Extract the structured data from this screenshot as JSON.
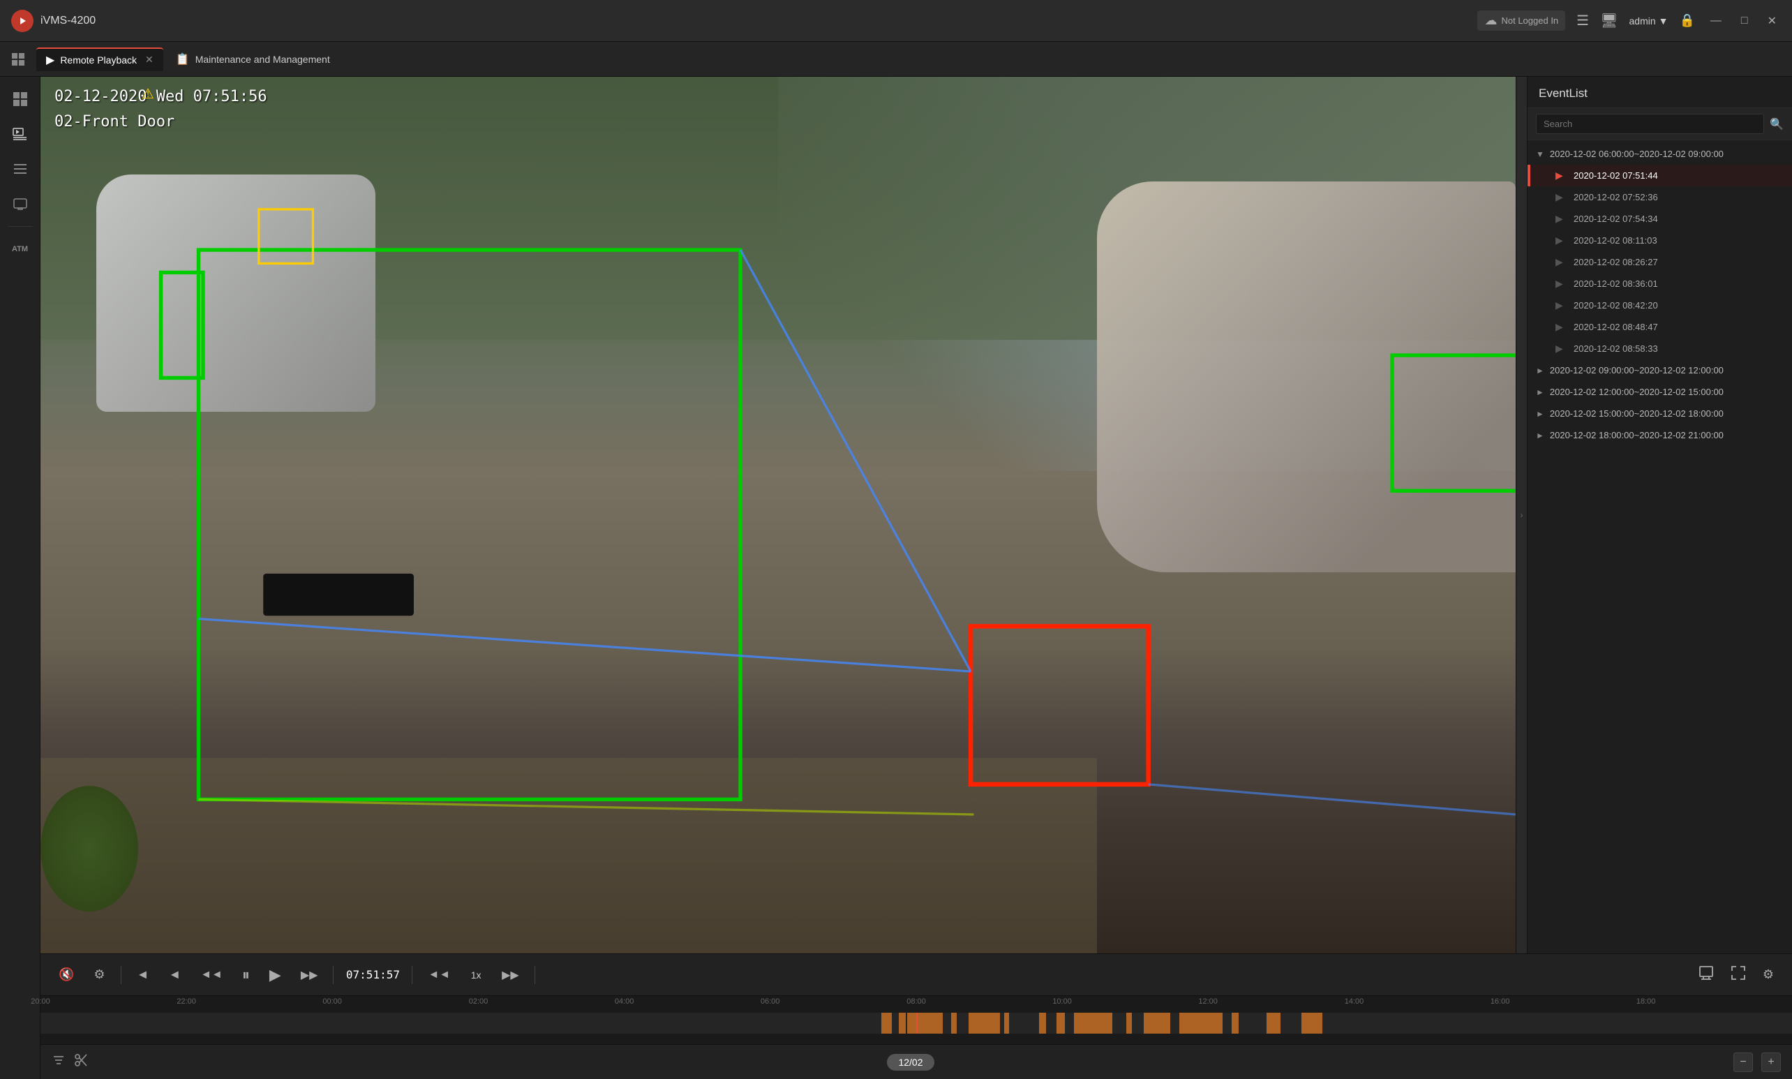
{
  "app": {
    "name": "iVMS-4200",
    "logo": "●"
  },
  "titlebar": {
    "cloud_status": "Not Logged In",
    "user": "admin",
    "win_min": "—",
    "win_max": "□",
    "win_close": "✕"
  },
  "tabs": [
    {
      "id": "remote-playback",
      "label": "Remote Playback",
      "active": true,
      "closable": true
    },
    {
      "id": "maintenance",
      "label": "Maintenance and Management",
      "active": false,
      "closable": false
    }
  ],
  "sidebar": {
    "items": [
      {
        "id": "grid",
        "icon": "⊞",
        "label": ""
      },
      {
        "id": "monitor",
        "icon": "▶",
        "label": ""
      },
      {
        "id": "list",
        "icon": "≡",
        "label": ""
      },
      {
        "id": "device",
        "icon": "▣",
        "label": ""
      },
      {
        "id": "atm",
        "icon": "ATM",
        "label": "ATM"
      }
    ]
  },
  "video": {
    "osd_datetime": "02-12-2020 Wed 07:51:56",
    "osd_camname": "02-Front Door",
    "warning_icon": "⚠"
  },
  "event_panel": {
    "title": "EventList",
    "search_placeholder": "Search",
    "groups": [
      {
        "id": "grp1",
        "label": "2020-12-02 06:00:00~2020-12-02 09:00:00",
        "expanded": true,
        "items": [
          {
            "time": "2020-12-02 07:51:44",
            "active": true
          },
          {
            "time": "2020-12-02 07:52:36",
            "active": false
          },
          {
            "time": "2020-12-02 07:54:34",
            "active": false
          },
          {
            "time": "2020-12-02 08:11:03",
            "active": false
          },
          {
            "time": "2020-12-02 08:26:27",
            "active": false
          },
          {
            "time": "2020-12-02 08:36:01",
            "active": false
          },
          {
            "time": "2020-12-02 08:42:20",
            "active": false
          },
          {
            "time": "2020-12-02 08:48:47",
            "active": false
          },
          {
            "time": "2020-12-02 08:58:33",
            "active": false
          }
        ]
      },
      {
        "id": "grp2",
        "label": "2020-12-02 09:00:00~2020-12-02 12:00:00",
        "expanded": false,
        "items": []
      },
      {
        "id": "grp3",
        "label": "2020-12-02 12:00:00~2020-12-02 15:00:00",
        "expanded": false,
        "items": []
      },
      {
        "id": "grp4",
        "label": "2020-12-02 15:00:00~2020-12-02 18:00:00",
        "expanded": false,
        "items": []
      },
      {
        "id": "grp5",
        "label": "2020-12-02 18:00:00~2020-12-02 21:00:00",
        "expanded": false,
        "items": []
      }
    ]
  },
  "playback": {
    "current_time": "07:51:57",
    "speed": "1x",
    "btn_mute": "🔇",
    "btn_settings_small": "⚙",
    "btn_prev_frame": "◄",
    "btn_slow": "◄◄",
    "btn_play": "▶",
    "btn_pause": "⏸",
    "btn_next_frame": "▶▶",
    "btn_fast": "▶▶",
    "btn_fullscreen": "⛶",
    "btn_clip": "✂",
    "btn_snapshot": "📷"
  },
  "timeline": {
    "labels": [
      "20:00",
      "22:00",
      "00:00",
      "02:00",
      "04:00",
      "06:00",
      "08:00",
      "10:00",
      "12:00",
      "14:00",
      "16:00",
      "18:00",
      "20:00"
    ],
    "cursor_pct": 50,
    "events": [
      {
        "start": 50,
        "width": 0.8
      },
      {
        "start": 51.5,
        "width": 0.5
      },
      {
        "start": 53,
        "width": 0.3
      },
      {
        "start": 54,
        "width": 1.5
      },
      {
        "start": 56,
        "width": 0.4
      },
      {
        "start": 57,
        "width": 2.0
      },
      {
        "start": 60,
        "width": 0.3
      },
      {
        "start": 62,
        "width": 1.0
      },
      {
        "start": 64,
        "width": 0.5
      },
      {
        "start": 66,
        "width": 2.5
      },
      {
        "start": 70,
        "width": 0.4
      },
      {
        "start": 72,
        "width": 1.2
      },
      {
        "start": 74,
        "width": 0.6
      },
      {
        "start": 76,
        "width": 0.8
      }
    ]
  },
  "bottombar": {
    "filter_icon": "⊟",
    "scissors_icon": "✂",
    "date": "12/02",
    "nav_prev": "−",
    "nav_next": "+"
  },
  "colors": {
    "accent": "#e74c3c",
    "detection_green": "#00cc00",
    "detection_red": "#ff2200",
    "timeline_event": "#e67e22"
  }
}
